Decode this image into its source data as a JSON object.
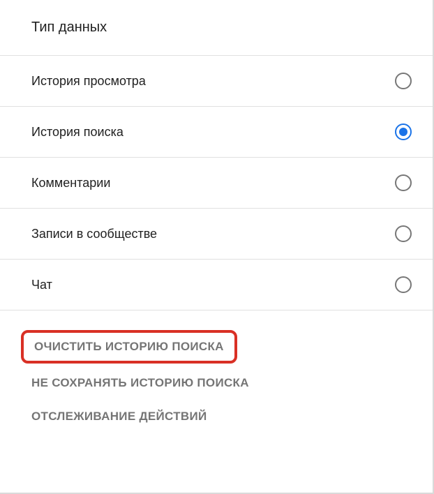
{
  "section": {
    "title": "Тип данных"
  },
  "options": [
    {
      "label": "История просмотра",
      "selected": false
    },
    {
      "label": "История поиска",
      "selected": true
    },
    {
      "label": "Комментарии",
      "selected": false
    },
    {
      "label": "Записи в сообществе",
      "selected": false
    },
    {
      "label": "Чат",
      "selected": false
    }
  ],
  "actions": {
    "clear": "ОЧИСТИТЬ ИСТОРИЮ ПОИСКА",
    "pause": "НЕ СОХРАНЯТЬ ИСТОРИЮ ПОИСКА",
    "track": "ОТСЛЕЖИВАНИЕ ДЕЙСТВИЙ"
  }
}
